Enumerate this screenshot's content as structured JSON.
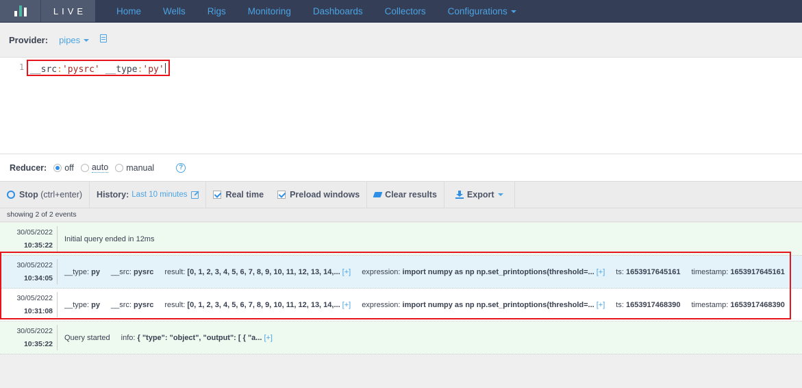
{
  "nav": {
    "brand": "LIVE",
    "items": [
      {
        "label": "Home"
      },
      {
        "label": "Wells"
      },
      {
        "label": "Rigs"
      },
      {
        "label": "Monitoring"
      },
      {
        "label": "Dashboards"
      },
      {
        "label": "Collectors"
      },
      {
        "label": "Configurations",
        "dropdown": true
      }
    ]
  },
  "provider": {
    "label": "Provider:",
    "value": "pipes"
  },
  "editor": {
    "line_number": "1",
    "tokens": {
      "k1": "__src",
      "op1": ":",
      "v1": "'pysrc'",
      "k2": " __type",
      "op2": ":",
      "v2": "'py'"
    }
  },
  "reducer": {
    "label": "Reducer:",
    "options": [
      {
        "label": "off",
        "selected": true
      },
      {
        "label": "auto",
        "selected": false
      },
      {
        "label": "manual",
        "selected": false
      }
    ],
    "help": "?"
  },
  "toolbar": {
    "stop_label": "Stop",
    "stop_shortcut": "(ctrl+enter)",
    "history_label": "History:",
    "history_value": "Last 10 minutes",
    "realtime_label": "Real time",
    "realtime_checked": true,
    "preload_label": "Preload windows",
    "preload_checked": true,
    "clear_label": "Clear results",
    "export_label": "Export"
  },
  "summary": "showing 2 of 2 events",
  "events": [
    {
      "date": "30/05/2022",
      "time": "10:35:22",
      "message": "Initial query ended in 12ms"
    },
    {
      "date": "30/05/2022",
      "time": "10:34:05",
      "type_key": "__type:",
      "type_val": "py",
      "src_key": "__src:",
      "src_val": "pysrc",
      "result_key": "result:",
      "result_val": "[0, 1, 2, 3, 4, 5, 6, 7, 8, 9, 10, 11, 12, 13, 14,...",
      "expr_key": "expression:",
      "expr_val": "import numpy as np np.set_printoptions(threshold=...",
      "ts_key": "ts:",
      "ts_val": "1653917645161",
      "timestamp_key": "timestamp:",
      "timestamp_val": "1653917645161",
      "expand": "[+]"
    },
    {
      "date": "30/05/2022",
      "time": "10:31:08",
      "type_key": "__type:",
      "type_val": "py",
      "src_key": "__src:",
      "src_val": "pysrc",
      "result_key": "result:",
      "result_val": "[0, 1, 2, 3, 4, 5, 6, 7, 8, 9, 10, 11, 12, 13, 14,...",
      "expr_key": "expression:",
      "expr_val": "import numpy as np np.set_printoptions(threshold=...",
      "ts_key": "ts:",
      "ts_val": "1653917468390",
      "timestamp_key": "timestamp:",
      "timestamp_val": "1653917468390",
      "expand": "[+]"
    },
    {
      "date": "30/05/2022",
      "time": "10:35:22",
      "message": "Query started",
      "info_key": "info:",
      "info_val": "{ \"type\": \"object\", \"output\": [ { \"a...",
      "expand": "[+]"
    }
  ],
  "colors": {
    "accent": "#4ba3e3",
    "nav_bg": "#343e56",
    "highlight": "#e8141b"
  }
}
